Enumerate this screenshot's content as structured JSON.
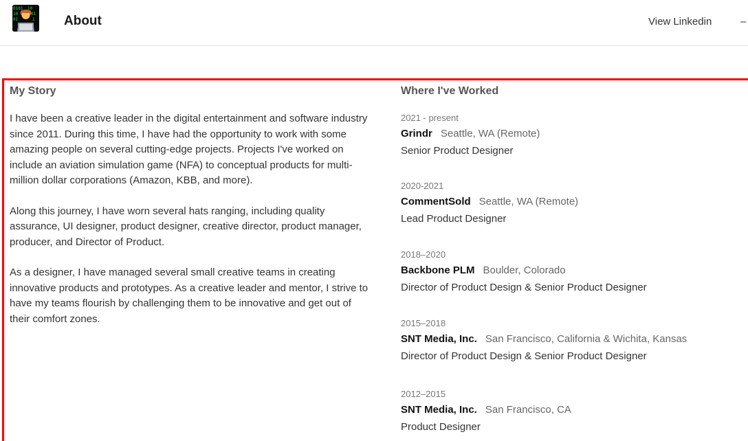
{
  "header": {
    "logo_icon": "developer-emoji-icon",
    "title": "About",
    "nav_link": "View Linkedin",
    "nav_sep": "–"
  },
  "story": {
    "title": "My Story",
    "paragraphs": [
      "I have been a creative leader in the digital entertainment and software industry since 2011. During this time, I have had the opportunity to work with some amazing people on several cutting-edge projects. Projects I've worked on include an aviation simulation game (NFA) to conceptual products for multi-million dollar corporations (Amazon, KBB, and more).",
      "Along this journey, I have worn several hats ranging, including quality assurance, UI designer, product designer, creative director, product manager, producer, and Director of Product.",
      "As a designer, I have managed several small creative teams in creating innovative products and prototypes. As a creative leader and mentor, I strive to have my teams flourish by challenging them to be innovative and get out of their comfort zones."
    ]
  },
  "work": {
    "title": "Where I've Worked",
    "jobs": [
      {
        "years": "2021 - present",
        "company": "Grindr",
        "location": "Seattle, WA (Remote)",
        "role": "Senior Product Designer"
      },
      {
        "years": "2020-2021",
        "company": "CommentSold",
        "location": "Seattle, WA (Remote)",
        "role": "Lead Product Designer"
      },
      {
        "years": "2018–2020",
        "company": "Backbone PLM",
        "location": "Boulder, Colorado",
        "role": "Director of Product Design & Senior Product Designer"
      },
      {
        "years": "2015–2018",
        "company": "SNT Media, Inc.",
        "location": "San Francisco, California & Wichita, Kansas",
        "role": "Director of Product Design & Senior Product Designer"
      },
      {
        "years": "2012–2015",
        "company": "SNT Media, Inc.",
        "location": "San Francisco, CA",
        "role": "Product Designer"
      }
    ]
  },
  "colors": {
    "highlight": "#ff0000",
    "text": "#333333",
    "muted": "#777777"
  }
}
